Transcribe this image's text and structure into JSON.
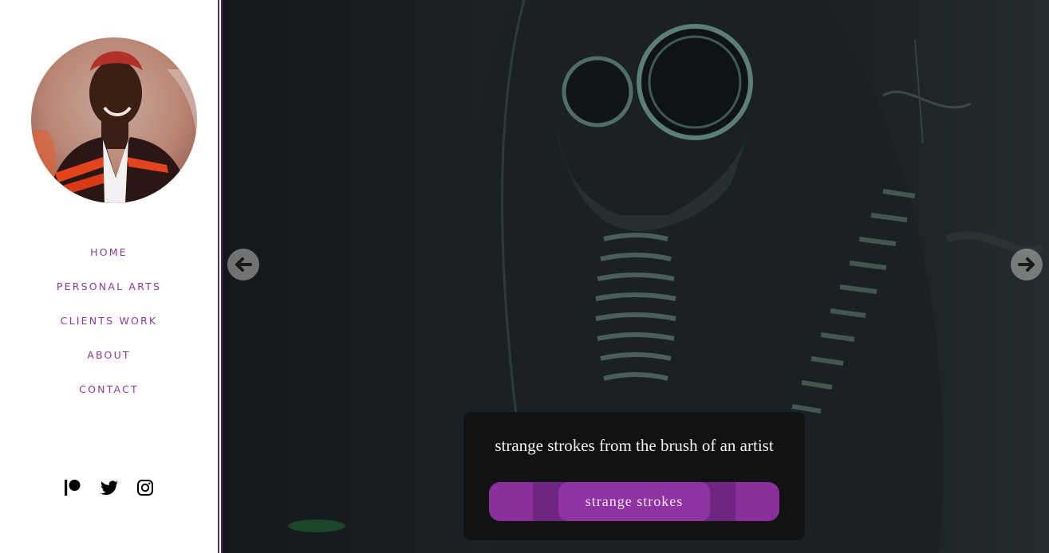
{
  "sidebar": {
    "avatar_icon": "artist-portrait",
    "nav": [
      {
        "label": "HOME"
      },
      {
        "label": "PERSONAL ARTS"
      },
      {
        "label": "CLIENTS WORK"
      },
      {
        "label": "ABOUT"
      },
      {
        "label": "CONTACT"
      }
    ],
    "socials": [
      {
        "icon": "patreon-icon"
      },
      {
        "icon": "twitter-icon"
      },
      {
        "icon": "instagram-icon"
      }
    ]
  },
  "hero": {
    "image_icon": "gas-mask-painting",
    "prev_icon": "arrow-left-icon",
    "next_icon": "arrow-right-icon",
    "caption": "strange strokes from the brush of an artist",
    "cta_label": "strange strokes"
  },
  "colors": {
    "accent": "#8a2f9c",
    "nav_text": "#8a3a9a",
    "hero_bg": "#171b1d"
  }
}
